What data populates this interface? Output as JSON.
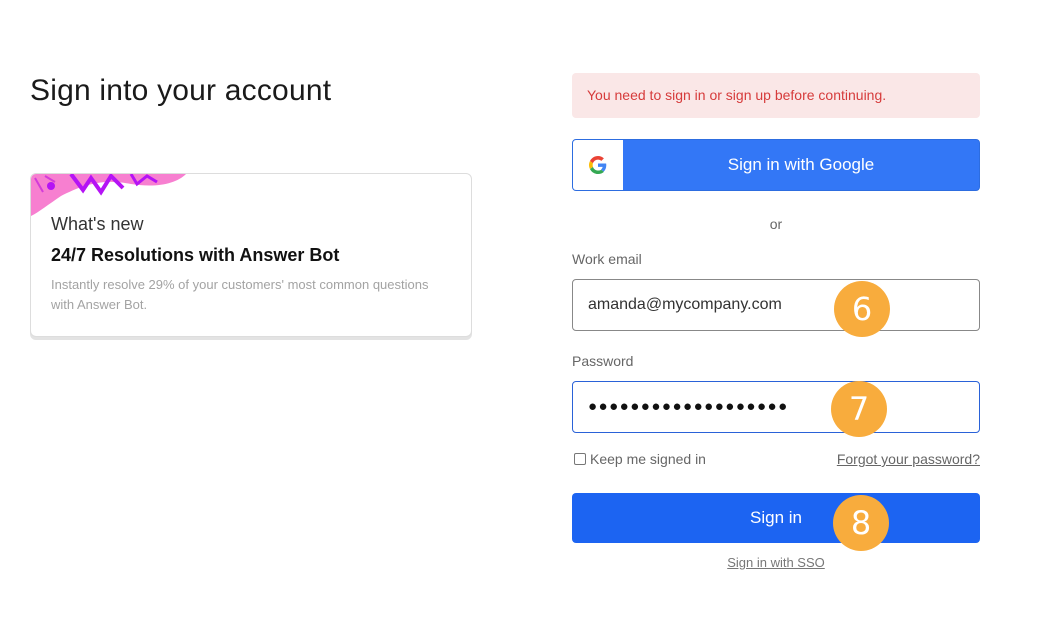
{
  "page": {
    "title": "Sign into your account"
  },
  "news_card": {
    "eyebrow": "What's new",
    "headline": "24/7 Resolutions with Answer Bot",
    "description": "Instantly resolve 29% of your customers' most common questions with Answer Bot."
  },
  "alert": {
    "message": "You need to sign in or sign up before continuing."
  },
  "google": {
    "label": "Sign in with Google"
  },
  "divider": {
    "text": "or"
  },
  "email": {
    "label": "Work email",
    "value": "amanda@mycompany.com"
  },
  "password": {
    "label": "Password",
    "value": "●●●●●●●●●●●●●●●●●●●"
  },
  "remember": {
    "label": "Keep me signed in",
    "checked": false
  },
  "forgot": {
    "label": "Forgot your password?"
  },
  "signin": {
    "label": "Sign in"
  },
  "sso": {
    "label": "Sign in with SSO"
  },
  "step_badges": [
    {
      "number": "6",
      "target": "email-field"
    },
    {
      "number": "7",
      "target": "password-field"
    },
    {
      "number": "8",
      "target": "sign-in-button"
    }
  ],
  "colors": {
    "primary_blue": "#1c64f2",
    "google_blue": "#3377f6",
    "alert_bg": "#fae7e7",
    "alert_text": "#d63b3b",
    "badge_orange": "#f8ac3d",
    "decor_pink": "#f77fd0",
    "decor_purple": "#b513f5"
  }
}
